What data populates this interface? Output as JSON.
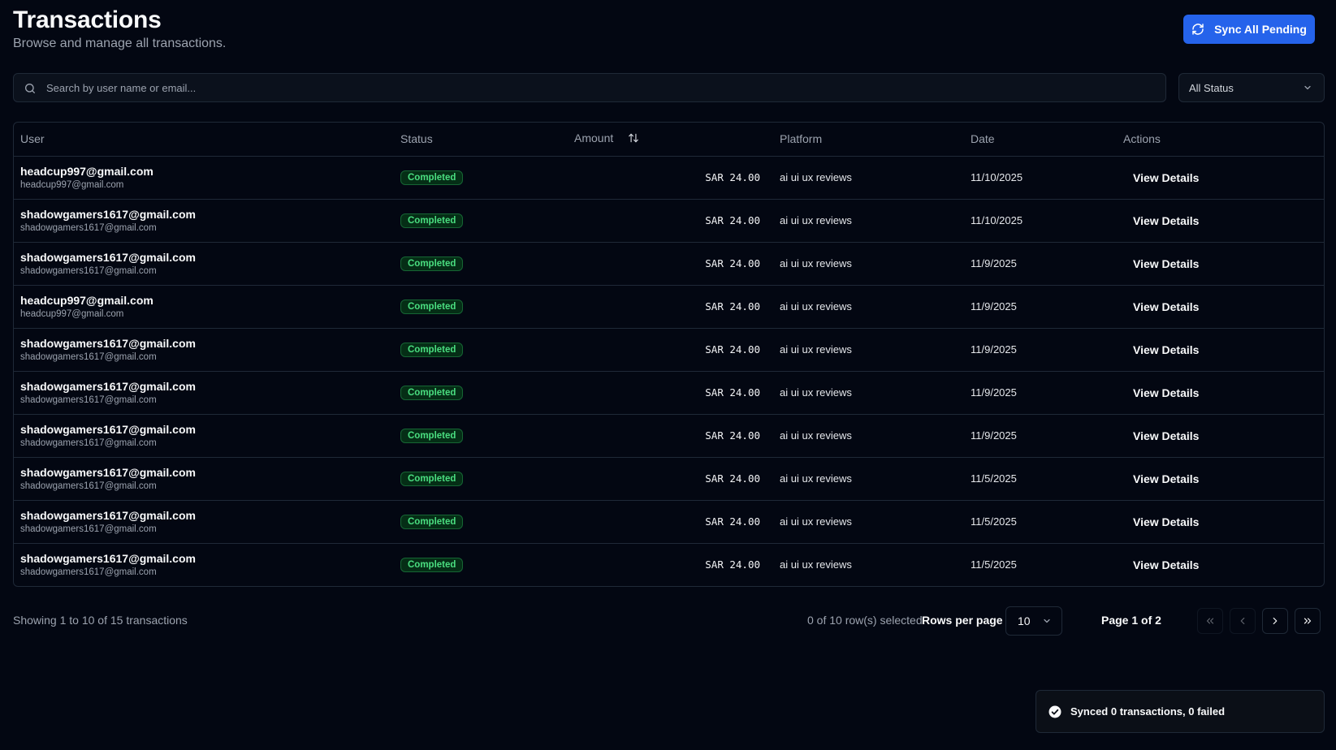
{
  "header": {
    "title": "Transactions",
    "subtitle": "Browse and manage all transactions.",
    "sync_label": "Sync All Pending"
  },
  "filters": {
    "search_placeholder": "Search by user name or email...",
    "status_value": "All Status"
  },
  "table": {
    "columns": {
      "user": "User",
      "status": "Status",
      "amount": "Amount",
      "platform": "Platform",
      "date": "Date",
      "actions": "Actions"
    },
    "rows": [
      {
        "name": "headcup997@gmail.com",
        "email": "headcup997@gmail.com",
        "status": "Completed",
        "amount": "SAR 24.00",
        "platform": "ai ui ux reviews",
        "date": "11/10/2025",
        "action": "View Details"
      },
      {
        "name": "shadowgamers1617@gmail.com",
        "email": "shadowgamers1617@gmail.com",
        "status": "Completed",
        "amount": "SAR 24.00",
        "platform": "ai ui ux reviews",
        "date": "11/10/2025",
        "action": "View Details"
      },
      {
        "name": "shadowgamers1617@gmail.com",
        "email": "shadowgamers1617@gmail.com",
        "status": "Completed",
        "amount": "SAR 24.00",
        "platform": "ai ui ux reviews",
        "date": "11/9/2025",
        "action": "View Details"
      },
      {
        "name": "headcup997@gmail.com",
        "email": "headcup997@gmail.com",
        "status": "Completed",
        "amount": "SAR 24.00",
        "platform": "ai ui ux reviews",
        "date": "11/9/2025",
        "action": "View Details"
      },
      {
        "name": "shadowgamers1617@gmail.com",
        "email": "shadowgamers1617@gmail.com",
        "status": "Completed",
        "amount": "SAR 24.00",
        "platform": "ai ui ux reviews",
        "date": "11/9/2025",
        "action": "View Details"
      },
      {
        "name": "shadowgamers1617@gmail.com",
        "email": "shadowgamers1617@gmail.com",
        "status": "Completed",
        "amount": "SAR 24.00",
        "platform": "ai ui ux reviews",
        "date": "11/9/2025",
        "action": "View Details"
      },
      {
        "name": "shadowgamers1617@gmail.com",
        "email": "shadowgamers1617@gmail.com",
        "status": "Completed",
        "amount": "SAR 24.00",
        "platform": "ai ui ux reviews",
        "date": "11/9/2025",
        "action": "View Details"
      },
      {
        "name": "shadowgamers1617@gmail.com",
        "email": "shadowgamers1617@gmail.com",
        "status": "Completed",
        "amount": "SAR 24.00",
        "platform": "ai ui ux reviews",
        "date": "11/5/2025",
        "action": "View Details"
      },
      {
        "name": "shadowgamers1617@gmail.com",
        "email": "shadowgamers1617@gmail.com",
        "status": "Completed",
        "amount": "SAR 24.00",
        "platform": "ai ui ux reviews",
        "date": "11/5/2025",
        "action": "View Details"
      },
      {
        "name": "shadowgamers1617@gmail.com",
        "email": "shadowgamers1617@gmail.com",
        "status": "Completed",
        "amount": "SAR 24.00",
        "platform": "ai ui ux reviews",
        "date": "11/5/2025",
        "action": "View Details"
      }
    ]
  },
  "footer": {
    "showing": "Showing 1 to 10 of 15 transactions",
    "selected": "0 of 10 row(s) selected.",
    "rows_per_page_label": "Rows per page",
    "rows_per_page_value": "10",
    "page_label": "Page 1 of 2"
  },
  "toast": {
    "message": "Synced 0 transactions, 0 failed"
  },
  "icons": {
    "sync": "refresh-icon",
    "search": "search-icon",
    "chevron": "chevron-down-icon",
    "sort": "sort-arrows-icon",
    "first": "chevrons-left-icon",
    "prev": "chevron-left-icon",
    "next": "chevron-right-icon",
    "last": "chevrons-right-icon",
    "toast": "check-circle-icon"
  },
  "colors": {
    "background": "#030712",
    "accent": "#2563eb",
    "success": "#4ade80",
    "border": "#1f2937"
  }
}
